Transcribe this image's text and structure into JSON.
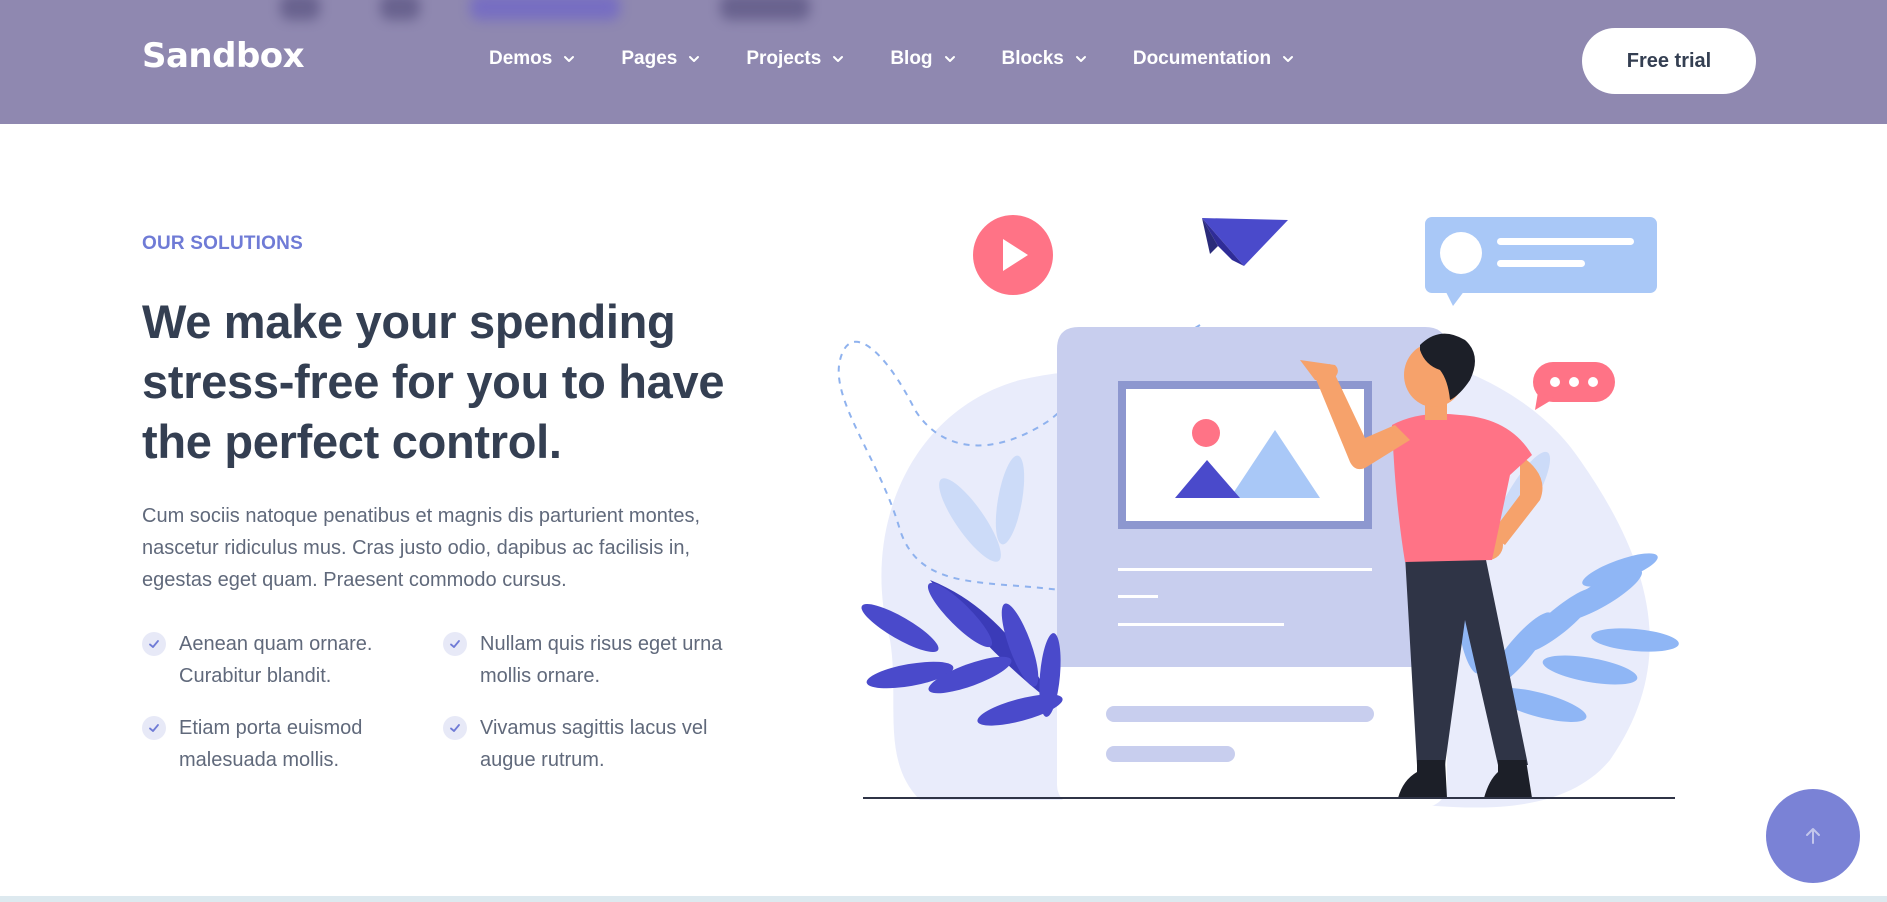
{
  "brand": {
    "logo_text": "Sandbox"
  },
  "nav": {
    "items": [
      {
        "label": "Demos"
      },
      {
        "label": "Pages"
      },
      {
        "label": "Projects"
      },
      {
        "label": "Blog"
      },
      {
        "label": "Blocks"
      },
      {
        "label": "Documentation"
      }
    ],
    "cta_label": "Free trial"
  },
  "hero": {
    "eyebrow": "OUR SOLUTIONS",
    "headline": "We make your spending stress-free for you to have the perfect control.",
    "lead": "Cum sociis natoque penatibus et magnis dis parturient montes, nascetur ridiculus mus. Cras justo odio, dapibus ac facilisis in, egestas eget quam. Praesent commodo cursus.",
    "features": [
      "Aenean quam ornare. Curabitur blandit.",
      "Nullam quis risus eget urna mollis ornare.",
      "Etiam porta euismod malesuada mollis.",
      "Vivamus sagittis lacus vel augue rutrum."
    ]
  },
  "icons": {
    "check": "check-icon",
    "chevron": "chevron-down-icon",
    "back_to_top": "arrow-up-icon"
  },
  "colors": {
    "header_bg": "#8f88b0",
    "accent": "#6f7bd6",
    "text_dark": "#343f52",
    "text_muted": "#60697b",
    "illustration_pink": "#ff7386",
    "illustration_blue": "#4a4acb"
  }
}
